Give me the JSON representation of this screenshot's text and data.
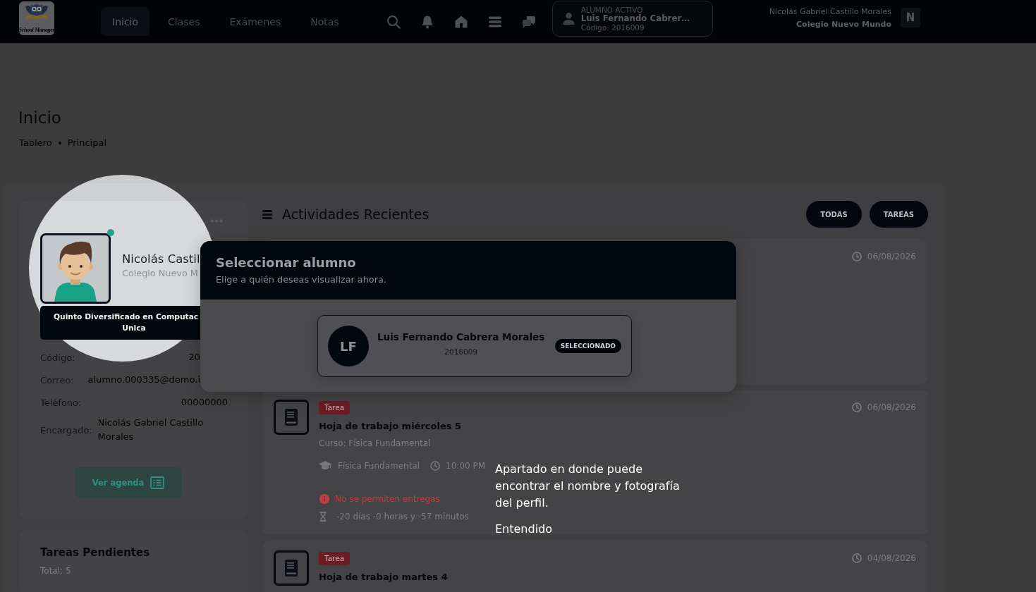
{
  "header": {
    "logo_text": "School Manager",
    "nav": [
      {
        "label": "Inicio",
        "selected": true
      },
      {
        "label": "Clases",
        "selected": false
      },
      {
        "label": "Exámenes",
        "selected": false
      },
      {
        "label": "Notas",
        "selected": false
      }
    ],
    "active_student": {
      "caption": "ALUMNO ACTIVO",
      "name": "Luis Fernando Cabrer…",
      "code": "Código: 2016009"
    },
    "user": {
      "name": "Nicolás Gabriel Castillo Morales",
      "school": "Colegio Nuevo Mundo",
      "initial": "N"
    }
  },
  "page": {
    "title": "Inicio",
    "breadcrumb": [
      "Tablero",
      "Principal"
    ]
  },
  "profile": {
    "name": "Nicolás Castil",
    "school": "Colegio Nuevo M",
    "online": true,
    "grade_lines": [
      "Quinto Diversificado en Computac",
      "Unica"
    ],
    "fields": [
      {
        "label": "Código:",
        "value": "20"
      },
      {
        "label": "Correo:",
        "value": "alumno.000335@demo.i"
      },
      {
        "label": "Teléfono:",
        "value": "00000000"
      },
      {
        "label": "Encargado:",
        "value": "Nicolás Gabriel Castillo Morales"
      }
    ],
    "agenda_button": "Ver agenda"
  },
  "pending": {
    "title": "Tareas Pendientes",
    "total": "Total: 5"
  },
  "activities": {
    "title": "Actividades Recientes",
    "filters": [
      "TODAS",
      "TAREAS"
    ],
    "items": [
      {
        "date": "06/08/2026"
      },
      {
        "badge": "Tarea",
        "date": "06/08/2026",
        "title": "Hoja de trabajo miércoles 5",
        "course": "Curso: Física Fundamental",
        "subject": "Física Fundamental",
        "time": "10:00 PM",
        "warning": "No se permiten entregas",
        "countdown": "-20 días -0 horas y -57 minutos"
      },
      {
        "badge": "Tarea",
        "date": "04/08/2026",
        "title": "Hoja de trabajo martes 4"
      }
    ]
  },
  "modal": {
    "title": "Seleccionar alumno",
    "subtitle": "Elige a quién deseas visualizar ahora.",
    "students": [
      {
        "initials": "LF",
        "name": "Luis Fernando Cabrera Morales",
        "code": "2016009",
        "badge": "SELECCIONADO",
        "selected": true
      }
    ]
  },
  "tour": {
    "text": "Apartado en donde puede encontrar el nombre y fotografía del perfil.",
    "button": "Entendido"
  }
}
